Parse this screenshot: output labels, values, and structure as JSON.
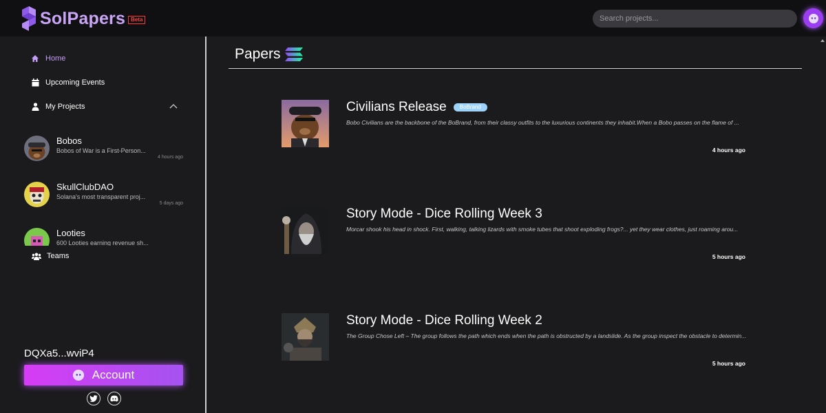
{
  "header": {
    "logo_text": "SolPapers",
    "beta_label": "Beta",
    "search_placeholder": "Search projects..."
  },
  "sidebar": {
    "home": "Home",
    "upcoming_events": "Upcoming Events",
    "my_projects": "My Projects",
    "projects": [
      {
        "name": "Bobos",
        "description": "Bobos of War is a First-Person...",
        "time": "4 hours ago"
      },
      {
        "name": "SkullClubDAO",
        "description": "Solana's most transparent proj...",
        "time": "5 days ago"
      },
      {
        "name": "Looties",
        "description": "600 Looties earning revenue sh...",
        "time": ""
      }
    ],
    "teams": "Teams",
    "wallet": "DQXa5...wviP4",
    "account_button": "Account"
  },
  "main": {
    "title": "Papers",
    "papers": [
      {
        "title": "Civilians Release",
        "tag": "BoBrand",
        "description": "Bobo Civilians are the backbone of the BoBrand, from their classy outfits to the luxurious continents they inhabit.When a Bobo passes on the flame of ...",
        "time": "4 hours ago"
      },
      {
        "title": "Story Mode - Dice Rolling Week 3",
        "tag": "",
        "description": "Morcar shook his head in shock. First, walking, talking lizards with smoke tubes that shoot exploding frogs?... yet they wear clothes, just roaming arou...",
        "time": "5 hours ago"
      },
      {
        "title": "Story Mode - Dice Rolling Week 2",
        "tag": "",
        "description": "The Group Chose Left – The group follows the path which ends when the path is obstructed by a landslide. As the group inspect the obstacle to determin...",
        "time": "5 hours ago"
      }
    ]
  },
  "colors": {
    "accent": "#c59cf7",
    "button": "#d63cf4",
    "tag": "#9ed3f9"
  }
}
